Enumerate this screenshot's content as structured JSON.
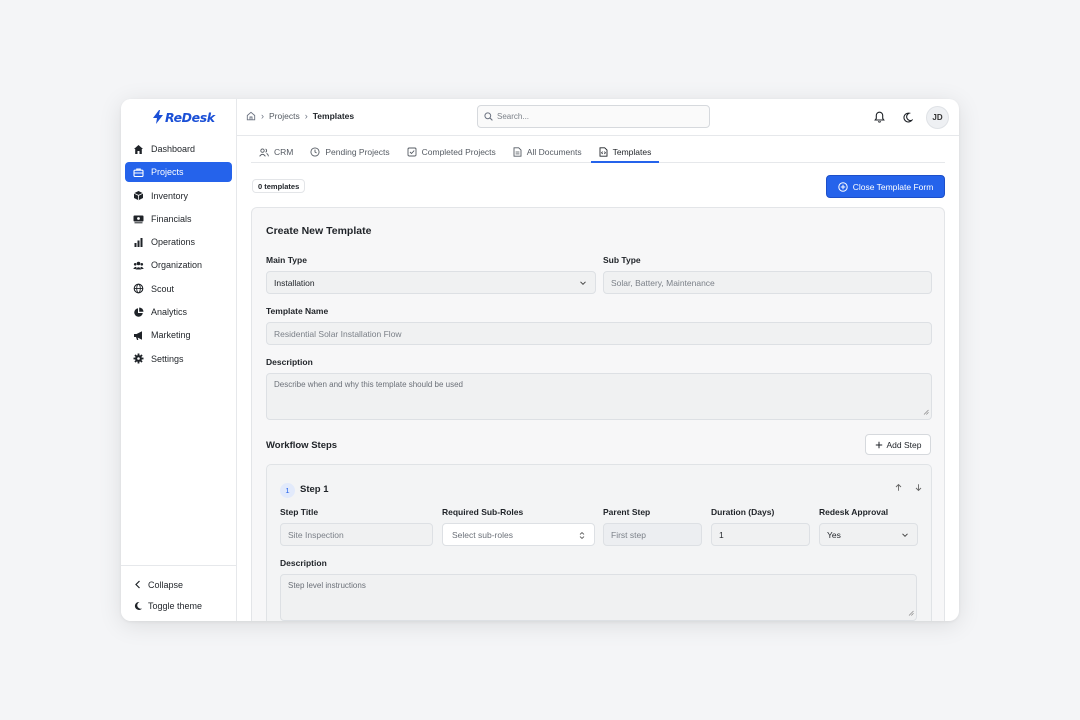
{
  "app": {
    "name": "ReDesk",
    "accent": "#2563eb"
  },
  "sidebar": {
    "items": [
      {
        "label": "Dashboard",
        "icon": "home-icon"
      },
      {
        "label": "Projects",
        "icon": "briefcase-icon",
        "active": true
      },
      {
        "label": "Inventory",
        "icon": "box-icon"
      },
      {
        "label": "Financials",
        "icon": "banknote-icon"
      },
      {
        "label": "Operations",
        "icon": "bar-chart-icon"
      },
      {
        "label": "Organization",
        "icon": "users-icon"
      },
      {
        "label": "Scout",
        "icon": "globe-icon"
      },
      {
        "label": "Analytics",
        "icon": "pie-chart-icon"
      },
      {
        "label": "Marketing",
        "icon": "megaphone-icon"
      },
      {
        "label": "Settings",
        "icon": "gear-icon"
      }
    ],
    "collapse_label": "Collapse",
    "toggle_theme_label": "Toggle theme"
  },
  "header": {
    "breadcrumb": {
      "parent": "Projects",
      "current": "Templates"
    },
    "search_placeholder": "Search...",
    "avatar_initials": "JD"
  },
  "tabs": [
    {
      "label": "CRM",
      "icon": "users-icon"
    },
    {
      "label": "Pending Projects",
      "icon": "clock-icon"
    },
    {
      "label": "Completed Projects",
      "icon": "check-square-icon"
    },
    {
      "label": "All Documents",
      "icon": "file-text-icon"
    },
    {
      "label": "Templates",
      "icon": "file-code-icon",
      "active": true
    }
  ],
  "toolbar": {
    "template_count": "0 templates",
    "close_form_label": "Close Template Form"
  },
  "form": {
    "title": "Create New Template",
    "main_type": {
      "label": "Main Type",
      "value": "Installation"
    },
    "sub_type": {
      "label": "Sub Type",
      "placeholder": "Solar, Battery, Maintenance"
    },
    "template_name": {
      "label": "Template Name",
      "placeholder": "Residential Solar Installation Flow"
    },
    "description": {
      "label": "Description",
      "placeholder": "Describe when and why this template should be used"
    },
    "workflow": {
      "title": "Workflow Steps",
      "add_step_label": "Add Step",
      "steps": [
        {
          "number": "1",
          "title": "Step 1",
          "step_title": {
            "label": "Step Title",
            "placeholder": "Site Inspection"
          },
          "sub_roles": {
            "label": "Required Sub-Roles",
            "placeholder": "Select sub-roles"
          },
          "parent_step": {
            "label": "Parent Step",
            "placeholder": "First step"
          },
          "duration": {
            "label": "Duration (Days)",
            "value": "1"
          },
          "approval": {
            "label": "Redesk Approval",
            "value": "Yes"
          },
          "description": {
            "label": "Description",
            "placeholder": "Step level instructions"
          }
        }
      ]
    }
  }
}
